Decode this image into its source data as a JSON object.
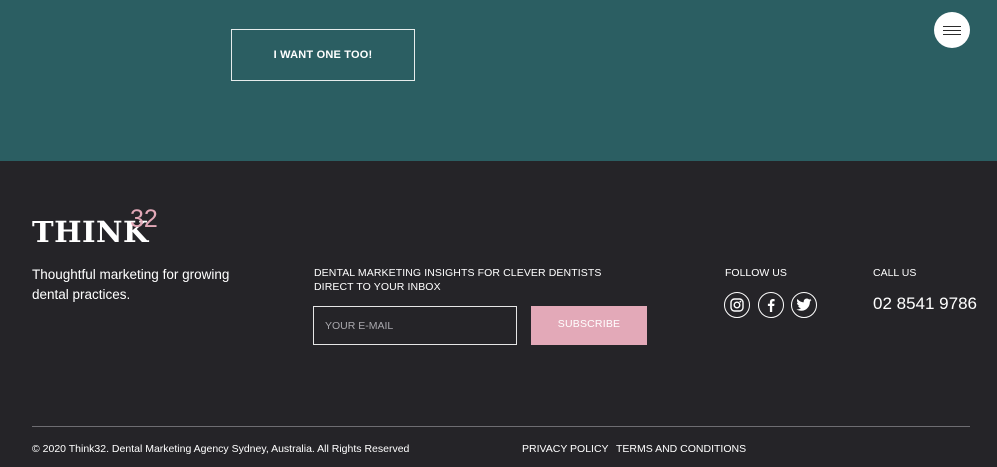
{
  "hero": {
    "cta_label": "I WANT ONE TOO!",
    "background_color": "#2b5e62",
    "menu_icon": "hamburger-menu-icon"
  },
  "footer": {
    "logo": {
      "word": "THINK",
      "superscript": "32"
    },
    "tagline": "Thoughtful marketing for growing dental practices.",
    "newsletter": {
      "heading_line1": "DENTAL MARKETING INSIGHTS FOR CLEVER DENTISTS",
      "heading_line2": "DIRECT TO YOUR INBOX",
      "email_placeholder": "YOUR E-MAIL",
      "subscribe_label": "SUBSCRIBE"
    },
    "follow": {
      "heading": "FOLLOW US",
      "icons": [
        "instagram-icon",
        "facebook-icon",
        "twitter-icon"
      ]
    },
    "call": {
      "heading": "CALL US",
      "phone": "02 8541 9786"
    },
    "bottom": {
      "copyright": "© 2020 Think32. Dental Marketing Agency Sydney, Australia. All Rights Reserved",
      "privacy_label": "PRIVACY POLICY",
      "terms_label": "TERMS AND CONDITIONS"
    },
    "background_color": "#252428",
    "accent_color": "#e3a9b8"
  }
}
